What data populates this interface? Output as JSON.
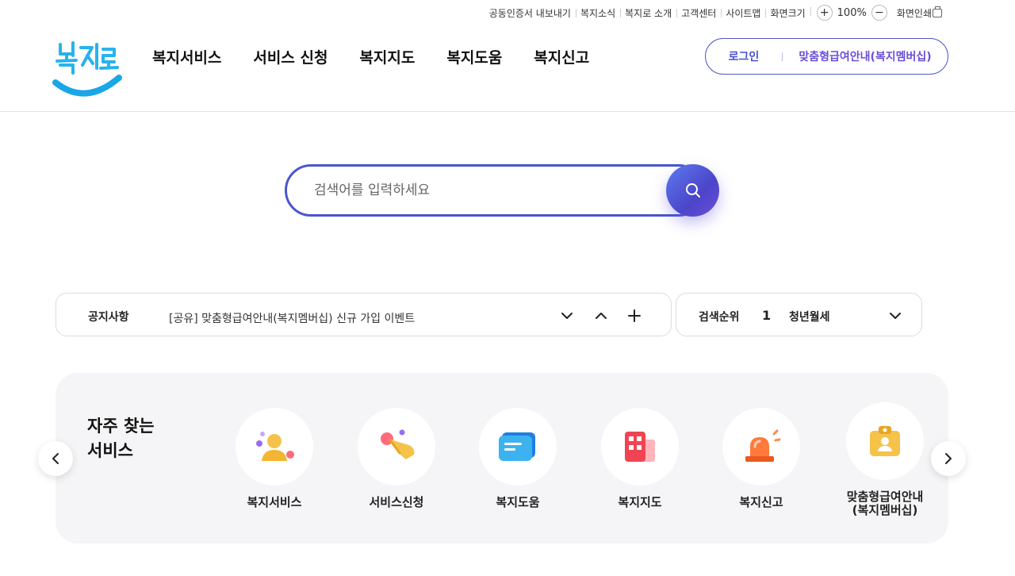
{
  "util": {
    "links": [
      "공동인증서 내보내기",
      "복지소식",
      "복지로 소개",
      "고객센터",
      "사이트맵",
      "화면크기"
    ],
    "zoom_in": "+",
    "zoom_value": "100%",
    "zoom_out": "−",
    "print": "화면인쇄"
  },
  "header": {
    "logo_text": "복지로",
    "nav": [
      "복지서비스",
      "서비스 신청",
      "복지지도",
      "복지도움",
      "복지신고"
    ],
    "login": "로그인",
    "membership": "맞춤형급여안내(복지멤버십)"
  },
  "search": {
    "placeholder": "검색어를 입력하세요"
  },
  "notice": {
    "label": "공지사항",
    "text": "[공유] 맞춤형급여안내(복지멤버십) 신규 가입 이벤트"
  },
  "ranking": {
    "label": "검색순위",
    "rank": "1",
    "term": "청년월세"
  },
  "frequent": {
    "title": "자주 찾는\n서비스",
    "items": [
      {
        "label": "복지서비스",
        "icon": "person-icon"
      },
      {
        "label": "서비스신청",
        "icon": "hand-touch-icon"
      },
      {
        "label": "복지도움",
        "icon": "chat-bubble-icon"
      },
      {
        "label": "복지지도",
        "icon": "building-icon"
      },
      {
        "label": "복지신고",
        "icon": "siren-icon"
      },
      {
        "label": "맞춤형급여안내\n(복지멤버십)",
        "icon": "id-badge-icon"
      }
    ]
  },
  "colors": {
    "brand": "#4a56cf",
    "accent_purple": "#6a4fd8",
    "logo_blue": "#27b3ec"
  }
}
